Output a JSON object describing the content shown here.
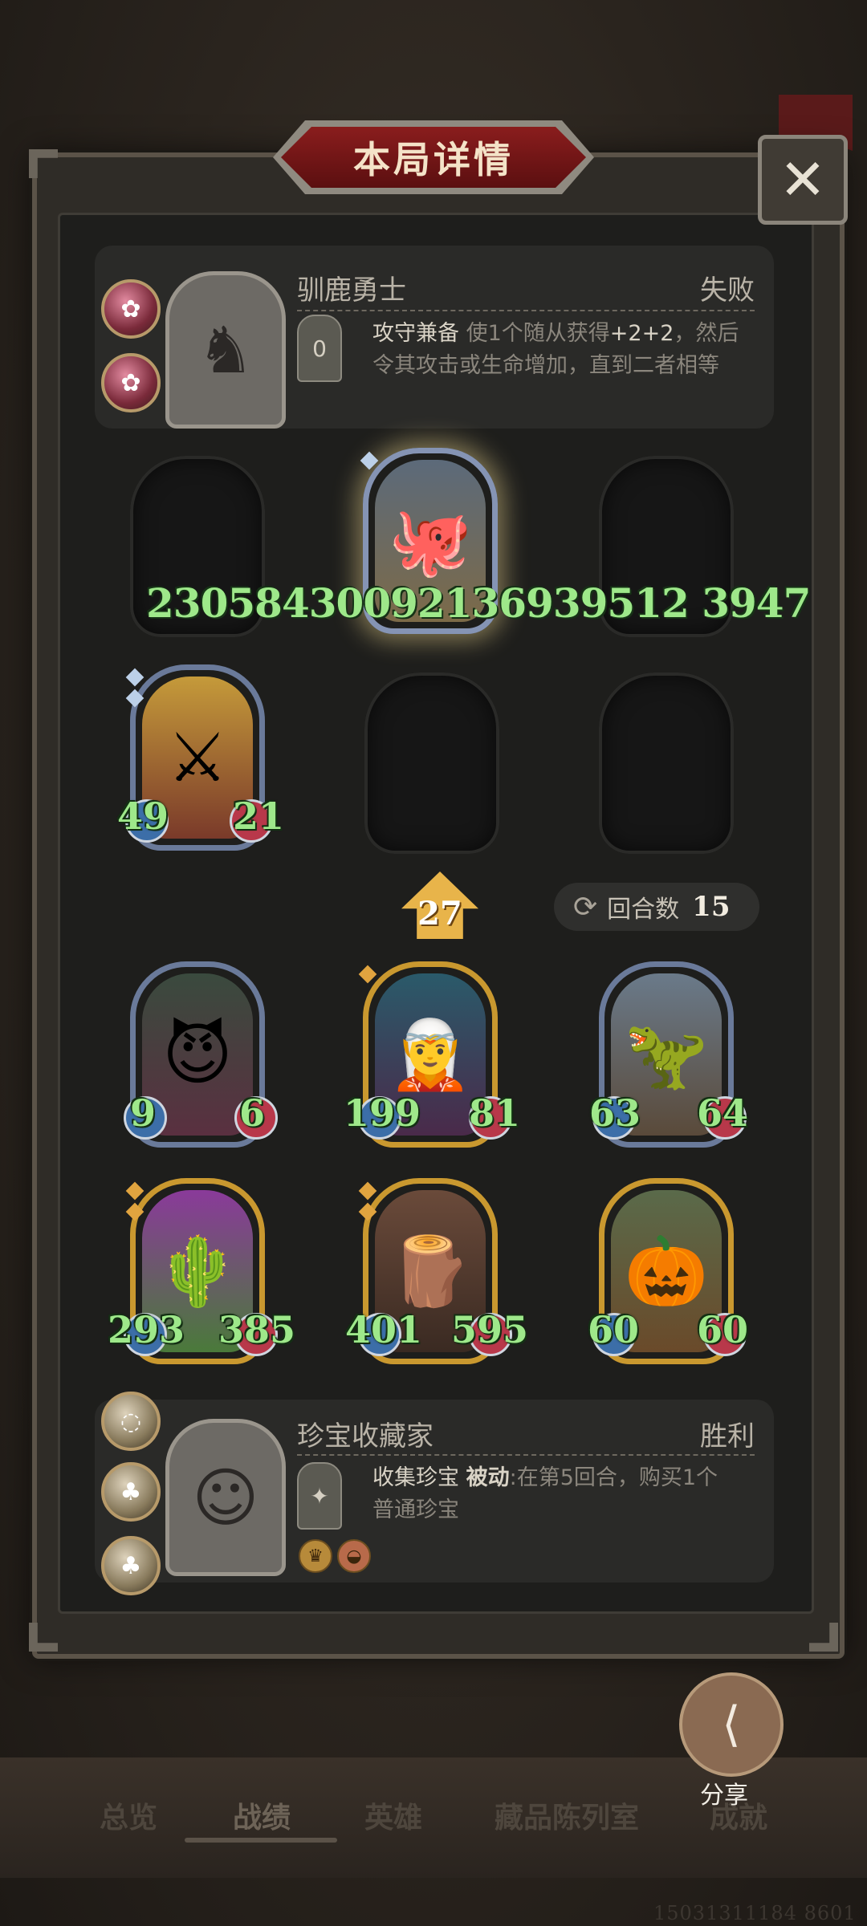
{
  "title": "本局详情",
  "close_icon": "✕",
  "top_player": {
    "hero_name": "驯鹿勇士",
    "result": "失败",
    "skill_name": "攻守兼备",
    "skill_desc_1a": "使1个随从获得",
    "skill_desc_1b": "+2+2",
    "skill_desc_1c": "，然后",
    "skill_desc_2": "令其攻击或生命增加，直到二者相等",
    "skill_cost": "0"
  },
  "overflow_stats": "23058430092136939512 3947",
  "board_enemy": [
    {
      "atk": "",
      "hp": ""
    },
    {
      "atk": "49",
      "hp": "21"
    }
  ],
  "tier": "27",
  "round_label": "回合数",
  "round_number": "15",
  "board_player": [
    {
      "atk": "9",
      "hp": "6"
    },
    {
      "atk": "199",
      "hp": "81"
    },
    {
      "atk": "63",
      "hp": "64"
    },
    {
      "atk": "293",
      "hp": "385"
    },
    {
      "atk": "401",
      "hp": "595"
    },
    {
      "atk": "60",
      "hp": "60"
    }
  ],
  "bottom_player": {
    "hero_name": "珍宝收藏家",
    "result": "胜利",
    "skill_name": "收集珍宝",
    "skill_passive": "被动",
    "skill_desc_1": ":在第5回合，购买1个",
    "skill_desc_2": "普通珍宝"
  },
  "share_label": "分享",
  "tabs": [
    "总览",
    "战绩",
    "英雄",
    "藏品陈列室",
    "成就"
  ],
  "watermark": "15031311184 8601",
  "colors": {
    "accent_red": "#8a1d1d",
    "stat_green": "#9ee88a",
    "gold_frame": "#c9982f"
  }
}
